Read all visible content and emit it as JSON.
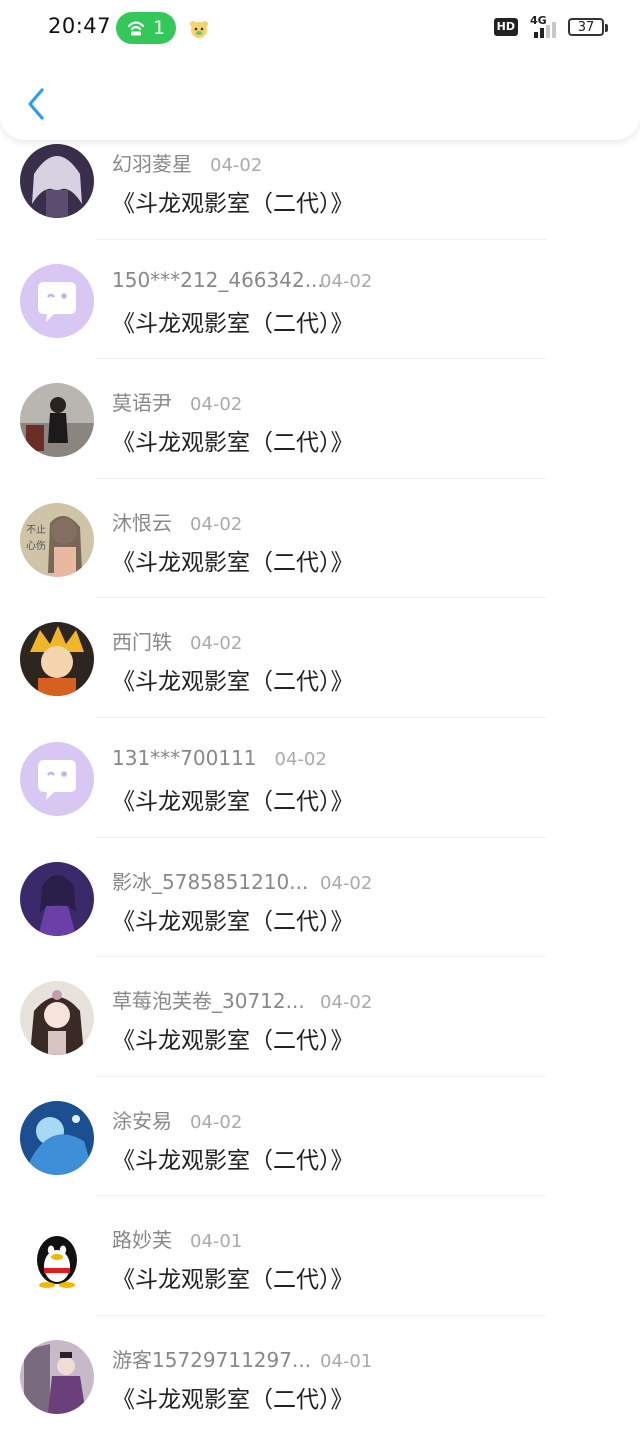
{
  "status_bar": {
    "time": "20:47",
    "hotspot_count": "1",
    "hd": "HD",
    "network": "4G",
    "battery": "37"
  },
  "nav": {
    "back_icon": "chevron-left-icon",
    "accent_color": "#2b9cf2"
  },
  "comments": [
    {
      "user": "幻羽菱星",
      "date": "04-02",
      "message": "《斗龙观影室（二代）》",
      "avatar": "anime-white-hair"
    },
    {
      "user": "150***212_466342...",
      "date": "04-02",
      "message": "《斗龙观影室（二代）》",
      "avatar": "default-chat-bubble"
    },
    {
      "user": "莫语尹",
      "date": "04-02",
      "message": "《斗龙观影室（二代）》",
      "avatar": "photo-girl-dark"
    },
    {
      "user": "沐恨云",
      "date": "04-02",
      "message": "《斗龙观影室（二代）》",
      "avatar": "photo-girl-text"
    },
    {
      "user": "西门轶",
      "date": "04-02",
      "message": "《斗龙观影室（二代）》",
      "avatar": "anime-orange-hair"
    },
    {
      "user": "131***700111",
      "date": "04-02",
      "message": "《斗龙观影室（二代）》",
      "avatar": "default-chat-bubble"
    },
    {
      "user": "影冰_5785851210...",
      "date": "04-02",
      "message": "《斗龙观影室（二代）》",
      "avatar": "anime-purple"
    },
    {
      "user": "草莓泡芙卷_30712...",
      "date": "04-02",
      "message": "《斗龙观影室（二代）》",
      "avatar": "anime-girl-dark-hair"
    },
    {
      "user": "涂安易",
      "date": "04-02",
      "message": "《斗龙观影室（二代）》",
      "avatar": "anime-blue"
    },
    {
      "user": "路妙芙",
      "date": "04-01",
      "message": "《斗龙观影室（二代）》",
      "avatar": "qq-penguin"
    },
    {
      "user": "游客15729711297...",
      "date": "04-01",
      "message": "《斗龙观影室（二代）》",
      "avatar": "photo-girl-hanfu"
    }
  ],
  "colors": {
    "name": "#888888",
    "date": "#aaaaaa",
    "message": "#222222",
    "hotspot": "#34c759",
    "default_avatar": "#d7c7f2"
  }
}
